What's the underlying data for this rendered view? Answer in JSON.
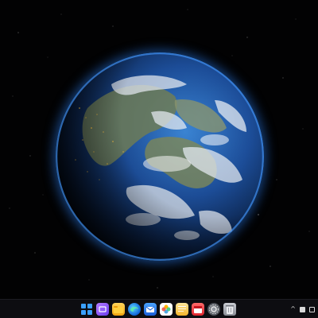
{
  "wallpaper": {
    "subject": "planet-earth-from-space",
    "background_color": "#020203",
    "atmosphere_color": "#2878e6",
    "ocean_color": "#1d4f9c",
    "land_color": "#7a8f6e",
    "city_lights_color": "#f5c14a"
  },
  "taskbar": {
    "background_color": "#0e0e12",
    "apps": [
      {
        "name": "start",
        "icon": "windows-logo-icon"
      },
      {
        "name": "purple-app",
        "icon": "purple-app-icon"
      },
      {
        "name": "files",
        "icon": "folder-icon"
      },
      {
        "name": "browser",
        "icon": "edge-browser-icon"
      },
      {
        "name": "mail",
        "icon": "mail-icon"
      },
      {
        "name": "photos",
        "icon": "photos-icon"
      },
      {
        "name": "notes",
        "icon": "notes-icon"
      },
      {
        "name": "calendar",
        "icon": "calendar-icon"
      },
      {
        "name": "settings",
        "icon": "settings-gear-icon"
      },
      {
        "name": "trash",
        "icon": "trash-icon"
      }
    ],
    "tray": {
      "chevron": "^",
      "icons": [
        "tray-window-icon",
        "tray-square-icon"
      ]
    }
  }
}
